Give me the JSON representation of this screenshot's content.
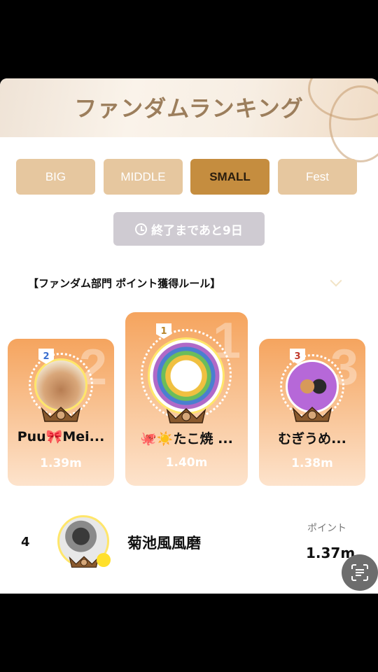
{
  "banner": {
    "title": "ファンダムランキング"
  },
  "tabs": [
    {
      "label": "BIG",
      "active": false
    },
    {
      "label": "MIDDLE",
      "active": false
    },
    {
      "label": "SMALL",
      "active": true
    },
    {
      "label": "Fest",
      "active": false
    }
  ],
  "timer": {
    "label": "終了まであと9日",
    "icon": "clock-icon"
  },
  "rules": {
    "label": "【ファンダム部門 ポイント獲得ルール】",
    "icon": "chevron-down-icon"
  },
  "podium": [
    {
      "rank": "2",
      "name": "Puu🎀Mei...",
      "score": "1.39m"
    },
    {
      "rank": "1",
      "name": "🐙☀️たこ焼 ...",
      "score": "1.40m"
    },
    {
      "rank": "3",
      "name": "むぎうめ...",
      "score": "1.38m"
    }
  ],
  "list": [
    {
      "rank": "4",
      "name": "菊池風風磨",
      "points_label": "ポイント",
      "points": "1.37m"
    }
  ],
  "colors": {
    "accent": "#c58d3f",
    "tab_inactive": "#e6c79f",
    "card_top": "#f5a45e",
    "timer_bg": "#cfcbd2"
  }
}
